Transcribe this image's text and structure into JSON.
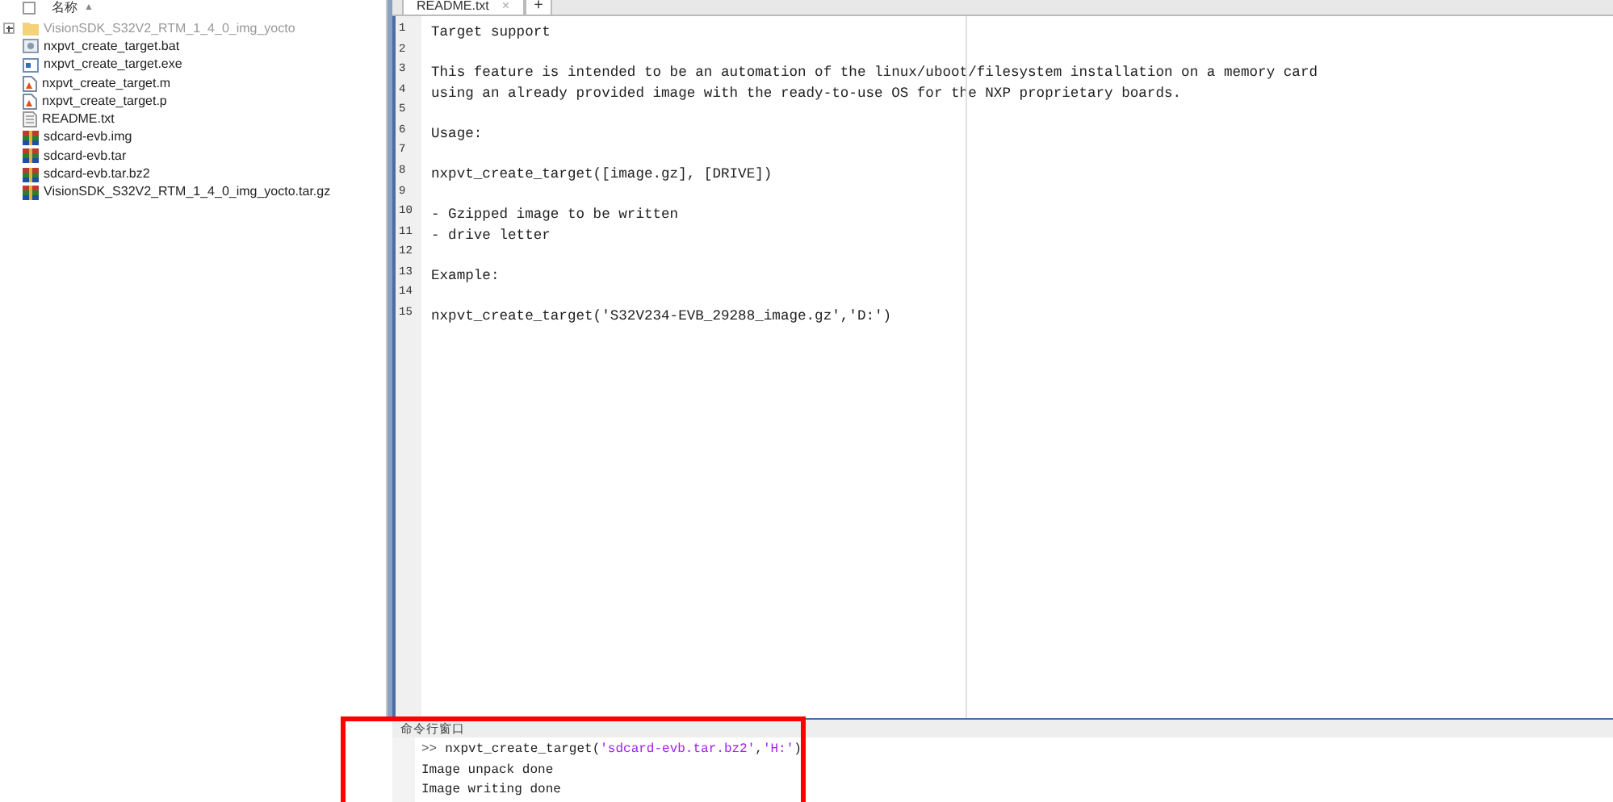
{
  "file_panel": {
    "header": {
      "checked": false,
      "label": "名称",
      "sort_mark": "▲"
    },
    "files": [
      {
        "name": "VisionSDK_S32V2_RTM_1_4_0_img_yocto",
        "kind": "folder",
        "expanded": false
      },
      {
        "name": "nxpvt_create_target.bat",
        "kind": "bat"
      },
      {
        "name": "nxpvt_create_target.exe",
        "kind": "exe"
      },
      {
        "name": "nxpvt_create_target.m",
        "kind": "script"
      },
      {
        "name": "nxpvt_create_target.p",
        "kind": "script"
      },
      {
        "name": "README.txt",
        "kind": "text"
      },
      {
        "name": "sdcard-evb.img",
        "kind": "archive"
      },
      {
        "name": "sdcard-evb.tar",
        "kind": "archive"
      },
      {
        "name": "sdcard-evb.tar.bz2",
        "kind": "archive"
      },
      {
        "name": "VisionSDK_S32V2_RTM_1_4_0_img_yocto.tar.gz",
        "kind": "archive"
      }
    ]
  },
  "editor": {
    "tabs": [
      {
        "label": "README.txt",
        "close": "×",
        "selected": true
      }
    ],
    "new_tab": "+",
    "lines": [
      {
        "number": "1",
        "text": "Target support"
      },
      {
        "number": "2"
      },
      {
        "number": "3",
        "text": "This feature is intended to be an automation of the linux/uboot/filesystem installation on a memory card"
      },
      {
        "number": "4",
        "text": "using an already provided image with the ready-to-use OS for the NXP proprietary boards."
      },
      {
        "number": "5"
      },
      {
        "number": "6",
        "text": "Usage:"
      },
      {
        "number": "7"
      },
      {
        "number": "8",
        "text": "nxpvt_create_target([image.gz], [DRIVE])"
      },
      {
        "number": "9"
      },
      {
        "number": "10",
        "text": "- Gzipped image to be written"
      },
      {
        "number": "11",
        "text": "- drive letter"
      },
      {
        "number": "12"
      },
      {
        "number": "13",
        "text": "Example:"
      },
      {
        "number": "14"
      },
      {
        "number": "15",
        "text": "nxpvt_create_target('S32V234-EVB_29288_image.gz','D:')"
      }
    ]
  },
  "command_window": {
    "title": "命令行窗口",
    "prompt": ">>",
    "command": [
      {
        "kind": "code",
        "text": "nxpvt_create_target("
      },
      {
        "kind": "string",
        "text": "'sdcard-evb.tar.bz2'"
      },
      {
        "kind": "code",
        "text": ","
      },
      {
        "kind": "string",
        "text": "'H:'"
      },
      {
        "kind": "code",
        "text": ")"
      }
    ],
    "output": [
      "Image unpack done",
      "Image writing done"
    ]
  },
  "highlight": {
    "color": "#ff0000"
  }
}
